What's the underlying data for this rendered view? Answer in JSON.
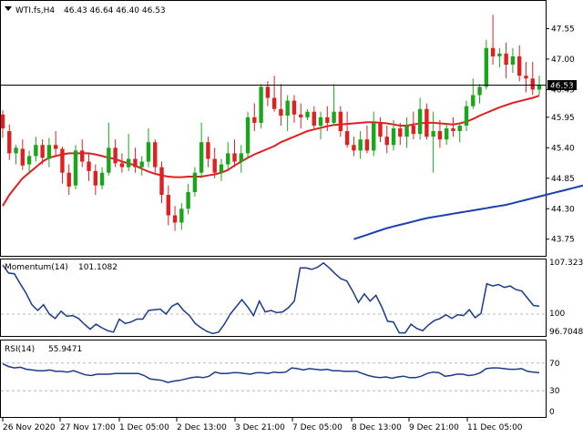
{
  "header": {
    "symbol_label": "WTI.fs,H4",
    "ohlc_label": "46.43 46.64 46.40 46.53"
  },
  "colors": {
    "bull": "#1aa51a",
    "bear": "#e02020",
    "ma_fast": "#e02020",
    "ma_slow": "#1a3fb0",
    "indicator": "#1a3a8c",
    "price_line": "#000000",
    "grid": "#b8b8b8"
  },
  "chart_data": [
    {
      "type": "candlestick",
      "title": "WTI.fs,H4",
      "ylim": [
        43.45,
        48.05
      ],
      "y_ticks": [
        "47.55",
        "47.00",
        "46.45",
        "45.95",
        "45.40",
        "44.85",
        "44.30",
        "43.75"
      ],
      "x_labels": [
        "26 Nov 2020",
        "27 Nov 17:00",
        "1 Dec 05:00",
        "2 Dec 13:00",
        "3 Dec 21:00",
        "7 Dec 05:00",
        "8 Dec 13:00",
        "9 Dec 21:00",
        "11 Dec 05:00"
      ],
      "current_price": "46.53",
      "candles": [
        [
          46.0,
          46.08,
          45.58,
          45.75
        ],
        [
          45.7,
          45.82,
          45.18,
          45.3
        ],
        [
          45.3,
          45.45,
          45.1,
          45.4
        ],
        [
          45.38,
          45.55,
          45.0,
          45.08
        ],
        [
          45.1,
          45.35,
          44.95,
          45.25
        ],
        [
          45.25,
          45.6,
          45.15,
          45.45
        ],
        [
          45.45,
          45.55,
          45.1,
          45.22
        ],
        [
          45.2,
          45.58,
          45.05,
          45.45
        ],
        [
          45.45,
          45.7,
          45.25,
          45.38
        ],
        [
          45.38,
          45.42,
          44.75,
          44.95
        ],
        [
          44.95,
          45.1,
          44.55,
          44.7
        ],
        [
          44.72,
          45.45,
          44.65,
          45.35
        ],
        [
          45.35,
          45.55,
          45.05,
          45.15
        ],
        [
          45.15,
          45.3,
          44.8,
          44.98
        ],
        [
          44.98,
          45.1,
          44.55,
          44.72
        ],
        [
          44.72,
          45.05,
          44.65,
          44.95
        ],
        [
          44.95,
          45.85,
          44.9,
          45.4
        ],
        [
          45.4,
          45.55,
          45.05,
          45.12
        ],
        [
          45.12,
          45.3,
          44.95,
          45.05
        ],
        [
          45.05,
          45.65,
          44.98,
          45.2
        ],
        [
          45.2,
          45.4,
          44.95,
          45.05
        ],
        [
          45.05,
          45.25,
          44.9,
          45.15
        ],
        [
          45.15,
          45.75,
          45.05,
          45.5
        ],
        [
          45.5,
          45.55,
          44.95,
          45.05
        ],
        [
          45.05,
          45.15,
          44.4,
          44.55
        ],
        [
          44.55,
          44.72,
          44.0,
          44.18
        ],
        [
          44.18,
          44.35,
          43.9,
          44.05
        ],
        [
          44.05,
          44.4,
          43.92,
          44.3
        ],
        [
          44.3,
          44.75,
          44.2,
          44.6
        ],
        [
          44.6,
          45.05,
          44.52,
          44.95
        ],
        [
          44.95,
          45.85,
          44.85,
          45.5
        ],
        [
          45.5,
          45.6,
          45.05,
          45.2
        ],
        [
          45.2,
          45.4,
          44.85,
          44.95
        ],
        [
          44.95,
          45.2,
          44.8,
          45.1
        ],
        [
          45.1,
          45.5,
          45.0,
          45.3
        ],
        [
          45.3,
          45.55,
          45.05,
          45.15
        ],
        [
          45.15,
          45.45,
          44.95,
          45.3
        ],
        [
          45.3,
          46.05,
          45.2,
          45.95
        ],
        [
          45.95,
          46.2,
          45.7,
          45.85
        ],
        [
          45.85,
          46.55,
          45.75,
          46.5
        ],
        [
          46.5,
          46.6,
          46.15,
          46.3
        ],
        [
          46.3,
          46.7,
          46.05,
          46.1
        ],
        [
          46.1,
          46.55,
          45.8,
          45.98
        ],
        [
          45.98,
          46.35,
          45.7,
          46.25
        ],
        [
          46.25,
          46.35,
          45.85,
          46.0
        ],
        [
          46.0,
          46.2,
          45.75,
          45.95
        ],
        [
          45.95,
          46.1,
          45.9,
          46.05
        ],
        [
          46.05,
          46.15,
          45.75,
          45.8
        ],
        [
          45.8,
          46.05,
          45.55,
          45.95
        ],
        [
          45.95,
          46.15,
          45.7,
          45.85
        ],
        [
          45.85,
          46.55,
          45.8,
          46.05
        ],
        [
          46.05,
          46.15,
          45.6,
          45.7
        ],
        [
          45.7,
          46.05,
          45.4,
          45.45
        ],
        [
          45.45,
          45.6,
          45.25,
          45.35
        ],
        [
          45.35,
          45.7,
          45.2,
          45.55
        ],
        [
          45.55,
          45.8,
          45.3,
          45.35
        ],
        [
          45.35,
          46.05,
          45.25,
          45.85
        ],
        [
          45.85,
          45.95,
          45.5,
          45.6
        ],
        [
          45.6,
          45.8,
          45.3,
          45.45
        ],
        [
          45.45,
          45.9,
          45.35,
          45.75
        ],
        [
          45.75,
          45.85,
          45.45,
          45.6
        ],
        [
          45.6,
          45.95,
          45.4,
          45.8
        ],
        [
          45.8,
          46.05,
          45.55,
          45.65
        ],
        [
          45.65,
          46.3,
          45.55,
          46.1
        ],
        [
          46.1,
          46.2,
          45.55,
          45.6
        ],
        [
          45.6,
          46.05,
          44.95,
          45.7
        ],
        [
          45.7,
          45.9,
          45.4,
          45.55
        ],
        [
          45.55,
          45.85,
          45.45,
          45.75
        ],
        [
          45.75,
          45.95,
          45.6,
          45.7
        ],
        [
          45.7,
          45.85,
          45.5,
          45.8
        ],
        [
          45.8,
          46.25,
          45.7,
          46.15
        ],
        [
          46.15,
          46.65,
          46.1,
          46.35
        ],
        [
          46.35,
          46.55,
          46.2,
          46.5
        ],
        [
          46.5,
          47.35,
          46.45,
          47.2
        ],
        [
          47.2,
          47.8,
          46.9,
          47.05
        ],
        [
          47.05,
          47.2,
          46.85,
          47.1
        ],
        [
          47.1,
          47.3,
          46.65,
          46.9
        ],
        [
          46.9,
          47.2,
          46.75,
          47.05
        ],
        [
          47.05,
          47.25,
          46.6,
          46.7
        ],
        [
          46.7,
          46.95,
          46.4,
          46.65
        ],
        [
          46.65,
          46.95,
          46.35,
          46.45
        ],
        [
          46.45,
          46.7,
          46.35,
          46.53
        ]
      ],
      "ma_fast": [
        44.35,
        44.55,
        44.7,
        44.85,
        44.95,
        45.05,
        45.15,
        45.22,
        45.25,
        45.28,
        45.3,
        45.3,
        45.3,
        45.3,
        45.28,
        45.25,
        45.22,
        45.2,
        45.15,
        45.12,
        45.08,
        45.02,
        44.97,
        44.93,
        44.9,
        44.88,
        44.87,
        44.87,
        44.88,
        44.88,
        44.88,
        44.9,
        44.92,
        44.95,
        45.0,
        45.08,
        45.15,
        45.22,
        45.28,
        45.33,
        45.38,
        45.43,
        45.5,
        45.55,
        45.6,
        45.65,
        45.7,
        45.73,
        45.76,
        45.79,
        45.81,
        45.82,
        45.83,
        45.84,
        45.85,
        45.86,
        45.86,
        45.85,
        45.84,
        45.82,
        45.8,
        45.8,
        45.82,
        45.84,
        45.85,
        45.85,
        45.84,
        45.83,
        45.82,
        45.84,
        45.87,
        45.92,
        45.98,
        46.03,
        46.08,
        46.13,
        46.17,
        46.21,
        46.24,
        46.27,
        46.3,
        46.34
      ],
      "ma_slow_start_index": 53,
      "ma_slow": [
        43.75,
        43.79,
        43.83,
        43.87,
        43.91,
        43.95,
        43.98,
        44.01,
        44.04,
        44.07,
        44.1,
        44.13,
        44.15,
        44.17,
        44.19,
        44.21,
        44.23,
        44.25,
        44.27,
        44.29,
        44.31,
        44.33,
        44.35,
        44.37,
        44.4,
        44.43,
        44.46,
        44.49,
        44.52,
        44.55,
        44.58,
        44.61,
        44.64,
        44.67,
        44.7,
        44.73,
        44.76,
        44.79,
        44.82
      ]
    },
    {
      "type": "line",
      "title": "Momentum(14)",
      "value_label": "101.1082",
      "y_ticks": [
        "107.3237",
        "100",
        "96.7048"
      ],
      "ylim": [
        96.7048,
        107.3237
      ],
      "values": [
        106.8,
        105.7,
        105.6,
        104.2,
        102.9,
        101.3,
        100.5,
        101.3,
        100.0,
        99.4,
        100.4,
        99.7,
        99.8,
        99.4,
        98.6,
        97.9,
        98.6,
        98.1,
        97.7,
        97.5,
        99.3,
        98.7,
        98.9,
        99.3,
        99.3,
        100.5,
        100.6,
        100.7,
        100.0,
        101.1,
        101.5,
        100.5,
        99.8,
        98.7,
        98.1,
        97.6,
        97.3,
        97.5,
        98.6,
        100.0,
        101.0,
        102.0,
        101.0,
        99.8,
        101.8,
        100.3,
        100.5,
        100.2,
        100.3,
        100.9,
        101.8,
        106.4,
        106.4,
        106.2,
        106.5,
        107.1,
        106.4,
        105.6,
        104.9,
        104.6,
        103.2,
        101.6,
        102.8,
        101.8,
        102.6,
        101.0,
        99.0,
        98.9,
        97.4,
        97.4,
        98.6,
        98.0,
        97.7,
        98.5,
        99.1,
        99.4,
        99.9,
        99.4,
        99.9,
        99.8,
        100.6,
        99.5,
        100.1,
        104.2,
        103.9,
        104.1,
        103.7,
        103.9,
        103.4,
        103.2,
        102.2,
        101.2,
        101.1
      ]
    },
    {
      "type": "line",
      "title": "RSI(14)",
      "value_label": "55.9471",
      "y_ticks": [
        "70",
        "30",
        "0"
      ],
      "levels": [
        70,
        30
      ],
      "ylim": [
        0,
        100
      ],
      "values": [
        69,
        65,
        63,
        64,
        61,
        60,
        59,
        59,
        60,
        58,
        58,
        57,
        59,
        56,
        53,
        52,
        54,
        54,
        54,
        55,
        55,
        55,
        55,
        55,
        52,
        47,
        46,
        45,
        42,
        44,
        45,
        47,
        49,
        50,
        49,
        51,
        57,
        55,
        55,
        56,
        56,
        55,
        54,
        56,
        56,
        55,
        57,
        56,
        57,
        63,
        62,
        60,
        62,
        61,
        60,
        61,
        59,
        59,
        58,
        58,
        58,
        55,
        52,
        50,
        49,
        50,
        48,
        50,
        51,
        49,
        49,
        51,
        55,
        57,
        56,
        51,
        52,
        54,
        54,
        52,
        53,
        56,
        62,
        63,
        63,
        62,
        61,
        61,
        62,
        58,
        57,
        56
      ]
    }
  ]
}
